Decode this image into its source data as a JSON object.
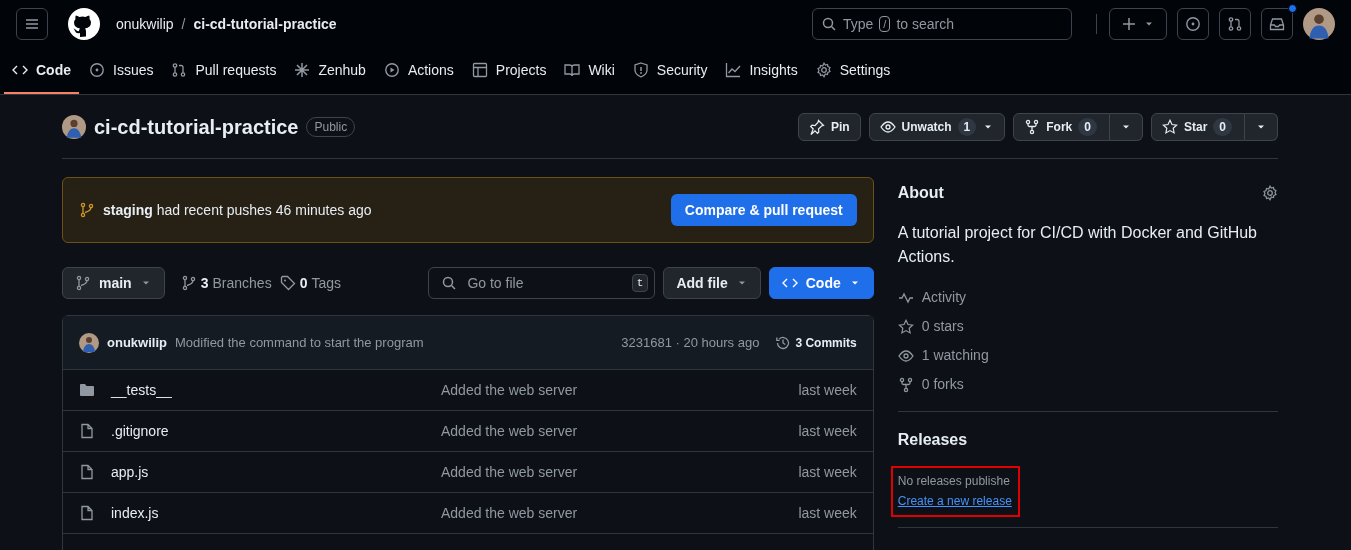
{
  "header": {
    "owner": "onukwilip",
    "separator": "/",
    "repo": "ci-cd-tutorial-practice",
    "search": {
      "before": "Type",
      "key": "/",
      "after": "to search"
    },
    "notifications_unread": true
  },
  "tabs": [
    {
      "label": "Code",
      "selected": true
    },
    {
      "label": "Issues",
      "selected": false
    },
    {
      "label": "Pull requests",
      "selected": false
    },
    {
      "label": "Zenhub",
      "selected": false
    },
    {
      "label": "Actions",
      "selected": false
    },
    {
      "label": "Projects",
      "selected": false
    },
    {
      "label": "Wiki",
      "selected": false
    },
    {
      "label": "Security",
      "selected": false
    },
    {
      "label": "Insights",
      "selected": false
    },
    {
      "label": "Settings",
      "selected": false
    }
  ],
  "repo": {
    "name": "ci-cd-tutorial-practice",
    "visibility": "Public",
    "pin": "Pin",
    "watch": {
      "label": "Unwatch",
      "count": "1"
    },
    "fork": {
      "label": "Fork",
      "count": "0"
    },
    "star": {
      "label": "Star",
      "count": "0"
    }
  },
  "banner": {
    "text": "**staging** had recent pushes 46 minutes ago",
    "button": "Compare & pull request"
  },
  "toolbar": {
    "branch": "main",
    "branches_count": "3",
    "branches_label": "Branches",
    "tags_count": "0",
    "tags_label": "Tags",
    "file_search": {
      "placeholder": "Go to file",
      "key": "t"
    },
    "add_file": "Add file",
    "code": "Code"
  },
  "commit": {
    "author": "onukwilip",
    "message": "Modified the command to start the program",
    "hash_time": "3231681 · 20 hours ago",
    "commits": "3 Commits"
  },
  "files": [
    {
      "kind": "folder",
      "name": "__tests__",
      "message": "Added the web server",
      "time": "last week"
    },
    {
      "kind": "file",
      "name": ".gitignore",
      "message": "Added the web server",
      "time": "last week"
    },
    {
      "kind": "file",
      "name": "app.js",
      "message": "Added the web server",
      "time": "last week"
    },
    {
      "kind": "file",
      "name": "index.js",
      "message": "Added the web server",
      "time": "last week"
    }
  ],
  "about": {
    "heading": "About",
    "description": "A tutorial project for CI/CD with Docker and GitHub Actions.",
    "stats": [
      "Activity",
      "0 stars",
      "1 watching",
      "0 forks"
    ]
  },
  "releases": {
    "heading": "Releases",
    "note": "No releases publishe",
    "link": "Create a new release",
    "highlighted": true
  }
}
